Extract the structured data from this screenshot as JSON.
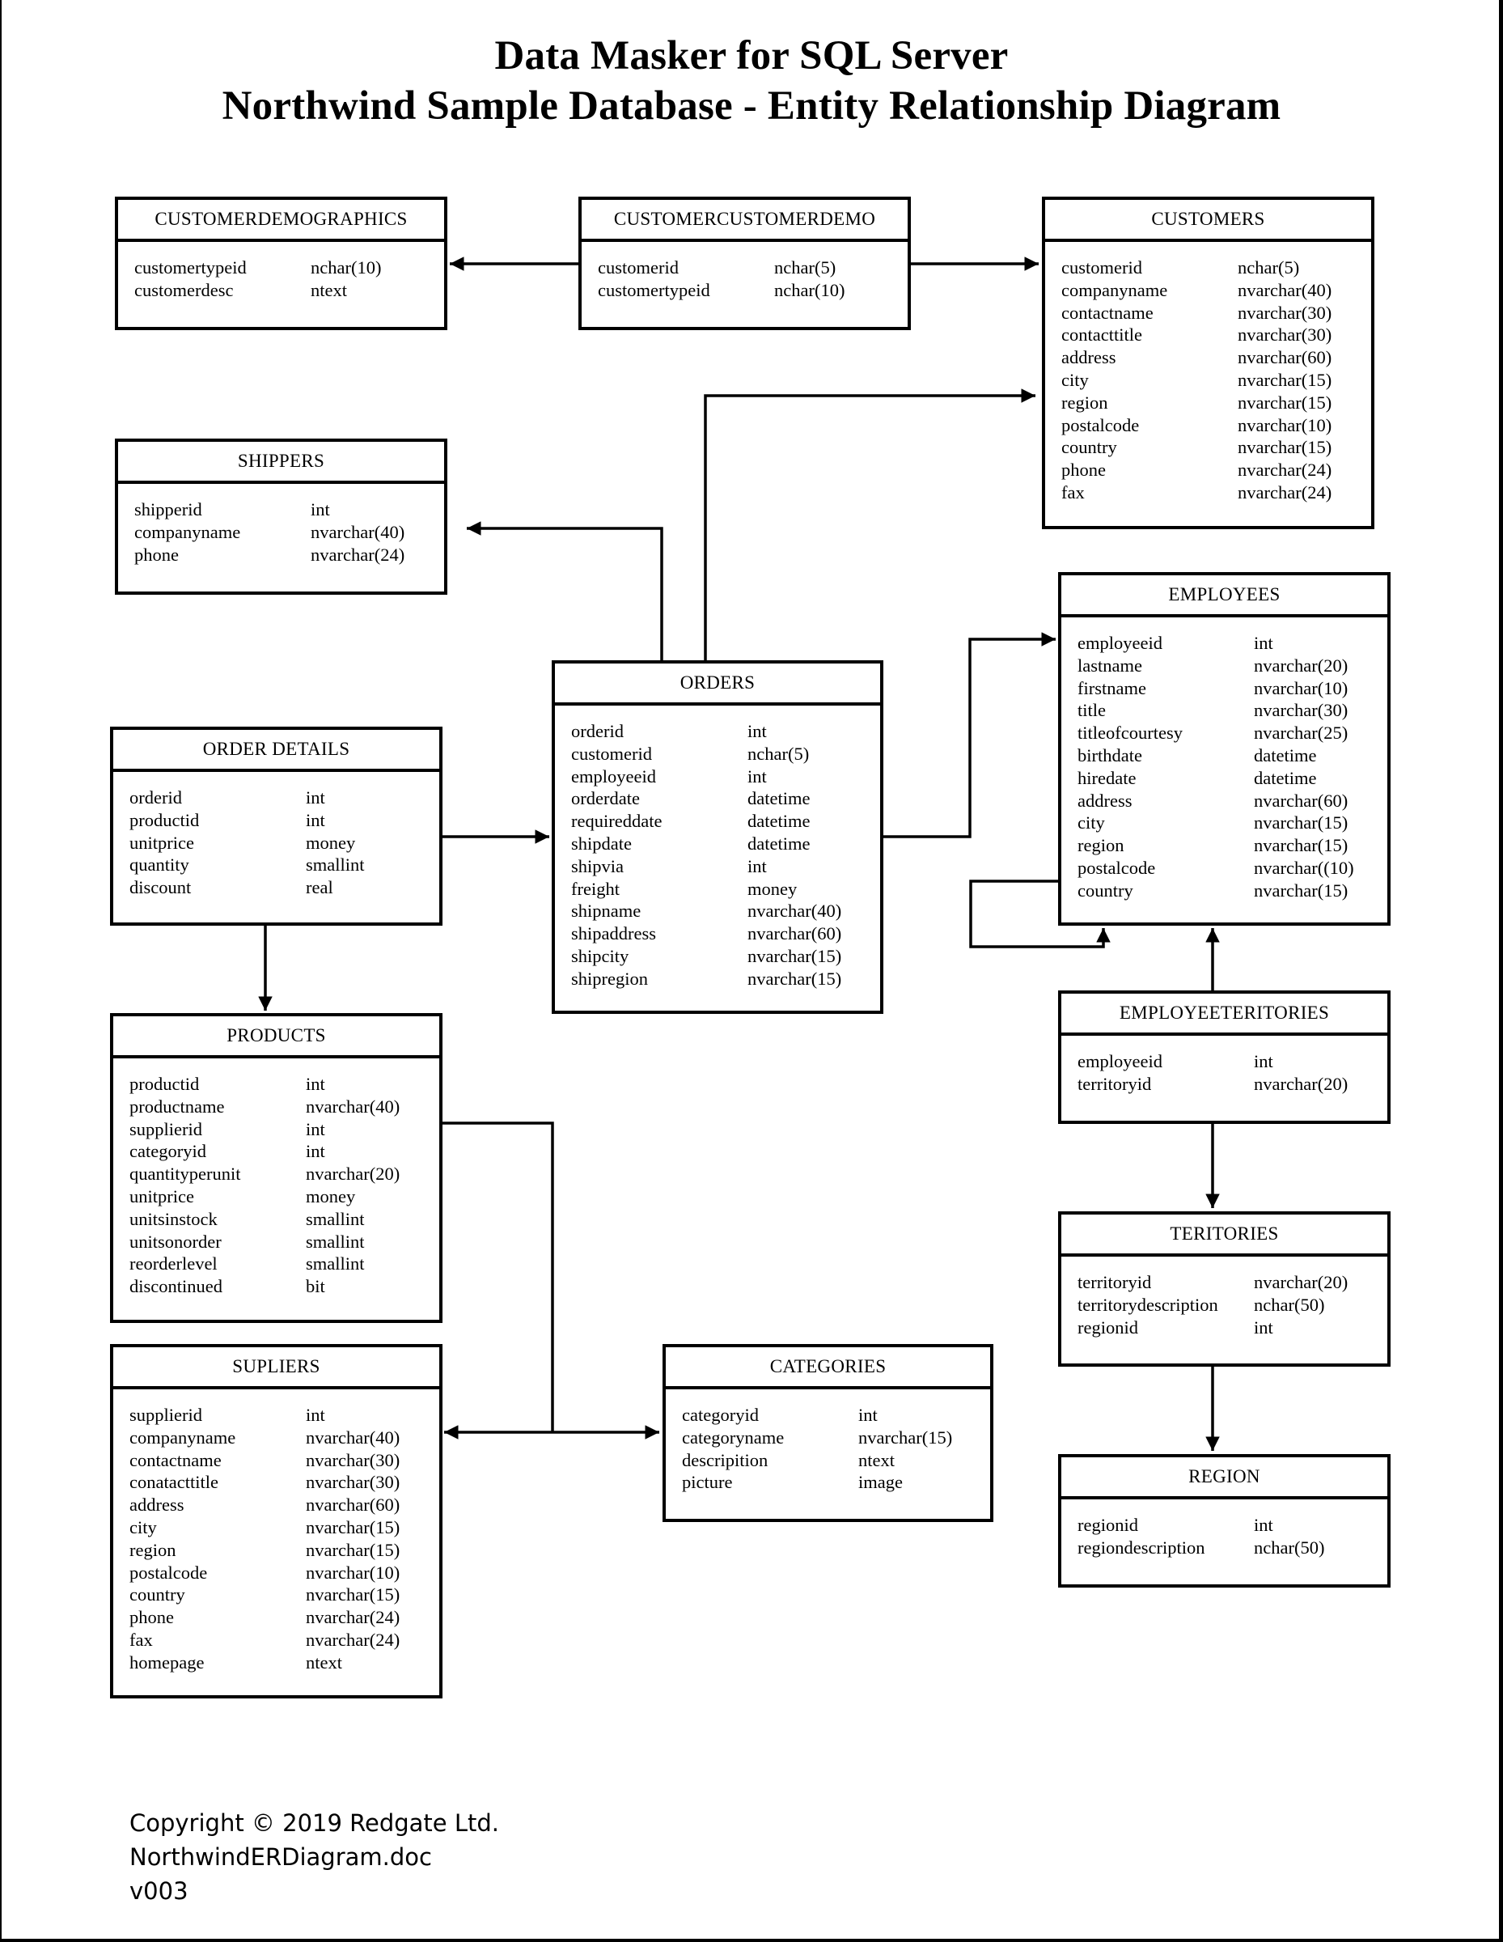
{
  "title": {
    "line1": "Data Masker for SQL Server",
    "line2": "Northwind Sample Database - Entity Relationship Diagram"
  },
  "entities": {
    "customerdemographics": {
      "name": "CUSTOMERDEMOGRAPHICS",
      "fields": [
        {
          "name": "customertypeid",
          "type": "nchar(10)"
        },
        {
          "name": "customerdesc",
          "type": "ntext"
        }
      ]
    },
    "customercustomerdemo": {
      "name": "CUSTOMERCUSTOMERDEMO",
      "fields": [
        {
          "name": "customerid",
          "type": "nchar(5)"
        },
        {
          "name": "customertypeid",
          "type": "nchar(10)"
        }
      ]
    },
    "customers": {
      "name": "CUSTOMERS",
      "fields": [
        {
          "name": "customerid",
          "type": "nchar(5)"
        },
        {
          "name": "companyname",
          "type": "nvarchar(40)"
        },
        {
          "name": "contactname",
          "type": "nvarchar(30)"
        },
        {
          "name": "contacttitle",
          "type": "nvarchar(30)"
        },
        {
          "name": "address",
          "type": "nvarchar(60)"
        },
        {
          "name": "city",
          "type": "nvarchar(15)"
        },
        {
          "name": "region",
          "type": "nvarchar(15)"
        },
        {
          "name": "postalcode",
          "type": "nvarchar(10)"
        },
        {
          "name": "country",
          "type": "nvarchar(15)"
        },
        {
          "name": "phone",
          "type": "nvarchar(24)"
        },
        {
          "name": "fax",
          "type": "nvarchar(24)"
        }
      ]
    },
    "shippers": {
      "name": "SHIPPERS",
      "fields": [
        {
          "name": "shipperid",
          "type": "int"
        },
        {
          "name": "companyname",
          "type": "nvarchar(40)"
        },
        {
          "name": "phone",
          "type": "nvarchar(24)"
        }
      ]
    },
    "employees": {
      "name": "EMPLOYEES",
      "fields": [
        {
          "name": "employeeid",
          "type": "int"
        },
        {
          "name": "lastname",
          "type": "nvarchar(20)"
        },
        {
          "name": "firstname",
          "type": "nvarchar(10)"
        },
        {
          "name": "title",
          "type": "nvarchar(30)"
        },
        {
          "name": "titleofcourtesy",
          "type": "nvarchar(25)"
        },
        {
          "name": "birthdate",
          "type": "datetime"
        },
        {
          "name": "hiredate",
          "type": "datetime"
        },
        {
          "name": "address",
          "type": "nvarchar(60)"
        },
        {
          "name": "city",
          "type": "nvarchar(15)"
        },
        {
          "name": "region",
          "type": "nvarchar(15)"
        },
        {
          "name": "postalcode",
          "type": "nvarchar((10)"
        },
        {
          "name": "country",
          "type": "nvarchar(15)"
        }
      ]
    },
    "orders": {
      "name": "ORDERS",
      "fields": [
        {
          "name": "orderid",
          "type": "int"
        },
        {
          "name": "customerid",
          "type": "nchar(5)"
        },
        {
          "name": "employeeid",
          "type": "int"
        },
        {
          "name": "orderdate",
          "type": "datetime"
        },
        {
          "name": "requireddate",
          "type": "datetime"
        },
        {
          "name": "shipdate",
          "type": "datetime"
        },
        {
          "name": "shipvia",
          "type": "int"
        },
        {
          "name": "freight",
          "type": "money"
        },
        {
          "name": "shipname",
          "type": "nvarchar(40)"
        },
        {
          "name": "shipaddress",
          "type": "nvarchar(60)"
        },
        {
          "name": "shipcity",
          "type": "nvarchar(15)"
        },
        {
          "name": "shipregion",
          "type": "nvarchar(15)"
        }
      ]
    },
    "orderdetails": {
      "name": "ORDER DETAILS",
      "fields": [
        {
          "name": "orderid",
          "type": "int"
        },
        {
          "name": "productid",
          "type": "int"
        },
        {
          "name": "unitprice",
          "type": "money"
        },
        {
          "name": "quantity",
          "type": "smallint"
        },
        {
          "name": "discount",
          "type": "real"
        }
      ]
    },
    "products": {
      "name": "PRODUCTS",
      "fields": [
        {
          "name": "productid",
          "type": "int"
        },
        {
          "name": "productname",
          "type": "nvarchar(40)"
        },
        {
          "name": "supplierid",
          "type": "int"
        },
        {
          "name": "categoryid",
          "type": "int"
        },
        {
          "name": "quantityperunit",
          "type": "nvarchar(20)"
        },
        {
          "name": "unitprice",
          "type": "money"
        },
        {
          "name": "unitsinstock",
          "type": "smallint"
        },
        {
          "name": "unitsonorder",
          "type": "smallint"
        },
        {
          "name": "reorderlevel",
          "type": "smallint"
        },
        {
          "name": "discontinued",
          "type": "bit"
        }
      ]
    },
    "employeeteritories": {
      "name": "EMPLOYEETERITORIES",
      "fields": [
        {
          "name": "employeeid",
          "type": "int"
        },
        {
          "name": "territoryid",
          "type": "nvarchar(20)"
        }
      ]
    },
    "teritories": {
      "name": "TERITORIES",
      "fields": [
        {
          "name": "territoryid",
          "type": "nvarchar(20)"
        },
        {
          "name": "territorydescription",
          "type": "nchar(50)"
        },
        {
          "name": "regionid",
          "type": "int"
        }
      ]
    },
    "supliers": {
      "name": "SUPLIERS",
      "fields": [
        {
          "name": "supplierid",
          "type": "int"
        },
        {
          "name": "companyname",
          "type": "nvarchar(40)"
        },
        {
          "name": "contactname",
          "type": "nvarchar(30)"
        },
        {
          "name": "conatacttitle",
          "type": "nvarchar(30)"
        },
        {
          "name": "address",
          "type": "nvarchar(60)"
        },
        {
          "name": "city",
          "type": "nvarchar(15)"
        },
        {
          "name": "region",
          "type": "nvarchar(15)"
        },
        {
          "name": "postalcode",
          "type": "nvarchar(10)"
        },
        {
          "name": "country",
          "type": "nvarchar(15)"
        },
        {
          "name": "phone",
          "type": "nvarchar(24)"
        },
        {
          "name": "fax",
          "type": "nvarchar(24)"
        },
        {
          "name": "homepage",
          "type": "ntext"
        }
      ]
    },
    "categories": {
      "name": "CATEGORIES",
      "fields": [
        {
          "name": "categoryid",
          "type": "int"
        },
        {
          "name": "categoryname",
          "type": "nvarchar(15)"
        },
        {
          "name": "descripition",
          "type": "ntext"
        },
        {
          "name": "picture",
          "type": "image"
        }
      ]
    },
    "region": {
      "name": "REGION",
      "fields": [
        {
          "name": "regionid",
          "type": "int"
        },
        {
          "name": "regiondescription",
          "type": "nchar(50)"
        }
      ]
    }
  },
  "relationships": [
    {
      "from": "CUSTOMERCUSTOMERDEMO",
      "to": "CUSTOMERDEMOGRAPHICS"
    },
    {
      "from": "CUSTOMERCUSTOMERDEMO",
      "to": "CUSTOMERS"
    },
    {
      "from": "ORDERS",
      "to": "SHIPPERS"
    },
    {
      "from": "ORDERS",
      "to": "CUSTOMERS"
    },
    {
      "from": "ORDERS",
      "to": "EMPLOYEES"
    },
    {
      "from": "EMPLOYEES",
      "to": "EMPLOYEES"
    },
    {
      "from": "ORDER DETAILS",
      "to": "ORDERS"
    },
    {
      "from": "ORDER DETAILS",
      "to": "PRODUCTS"
    },
    {
      "from": "PRODUCTS",
      "to": "SUPLIERS"
    },
    {
      "from": "PRODUCTS",
      "to": "CATEGORIES"
    },
    {
      "from": "EMPLOYEETERITORIES",
      "to": "EMPLOYEES"
    },
    {
      "from": "EMPLOYEETERITORIES",
      "to": "TERITORIES"
    },
    {
      "from": "TERITORIES",
      "to": "REGION"
    }
  ],
  "footer": {
    "copyright": "Copyright © 2019 Redgate Ltd.",
    "filename": "NorthwindERDiagram.doc",
    "version": "v003"
  }
}
